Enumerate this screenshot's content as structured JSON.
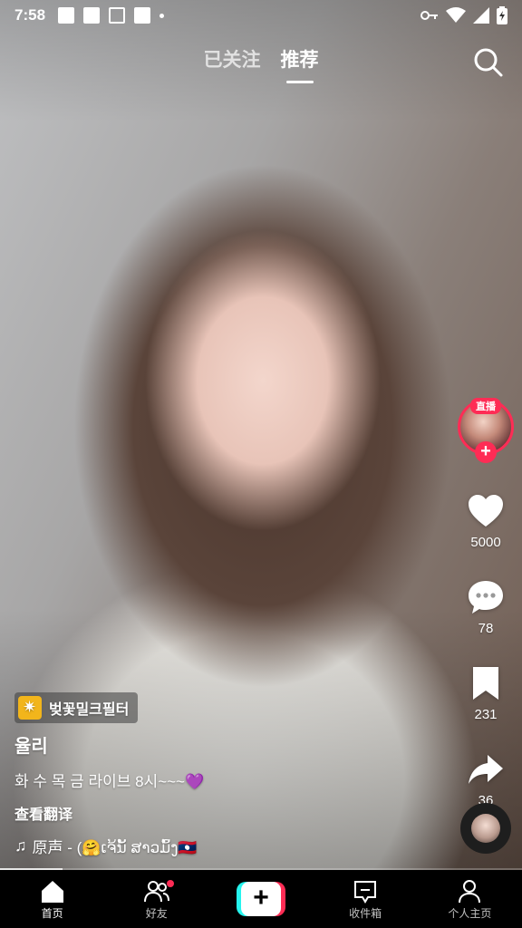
{
  "status_bar": {
    "time": "7:58",
    "icons": [
      "image-icon",
      "pen-icon",
      "font-icon",
      "square-icon",
      "dot-icon"
    ],
    "right_icons": [
      "key-icon",
      "wifi-icon",
      "signal-icon",
      "battery-icon"
    ]
  },
  "top_tabs": {
    "following": "已关注",
    "recommend": "推荐",
    "active": "recommend"
  },
  "right_rail": {
    "live_badge": "直播",
    "likes": "5000",
    "comments": "78",
    "favorites": "231",
    "shares": "36"
  },
  "info": {
    "filter_label": "벚꽃밀크필터",
    "author": "율리",
    "description": "화 수 목 금 라이브 8시~~~💜",
    "translate": "查看翻译",
    "music": "原声 - (🤗ເຈ້ນັ້ ສາວມົ້ງ🇱🇦"
  },
  "playback": {
    "progress": 0.12
  },
  "bottom_nav": {
    "home": "首页",
    "friends": "好友",
    "inbox": "收件箱",
    "profile": "个人主页",
    "create": "+"
  },
  "colors": {
    "accent": "#fe2c55",
    "cyan": "#25f4ee",
    "filter_chip_icon": "#f2b51b"
  }
}
